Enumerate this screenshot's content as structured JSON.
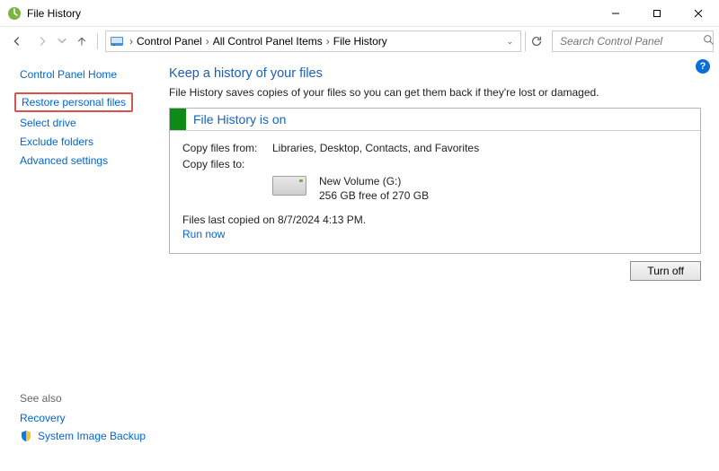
{
  "window": {
    "title": "File History",
    "controls": {
      "min": "—",
      "max": "▢",
      "close": "✕"
    }
  },
  "navbar": {
    "breadcrumbs": [
      "Control Panel",
      "All Control Panel Items",
      "File History"
    ],
    "search_placeholder": "Search Control Panel"
  },
  "sidebar": {
    "home": "Control Panel Home",
    "links": [
      {
        "label": "Restore personal files",
        "highlight": true
      },
      {
        "label": "Select drive",
        "highlight": false
      },
      {
        "label": "Exclude folders",
        "highlight": false
      },
      {
        "label": "Advanced settings",
        "highlight": false
      }
    ],
    "see_also_heading": "See also",
    "see_also": [
      {
        "label": "Recovery",
        "shield": false
      },
      {
        "label": "System Image Backup",
        "shield": true
      }
    ]
  },
  "main": {
    "title": "Keep a history of your files",
    "description": "File History saves copies of your files so you can get them back if they're lost or damaged.",
    "panel_header": "File History is on",
    "copy_from_label": "Copy files from:",
    "copy_from_value": "Libraries, Desktop, Contacts, and Favorites",
    "copy_to_label": "Copy files to:",
    "drive_name": "New Volume (G:)",
    "drive_free": "256 GB free of 270 GB",
    "last_copy": "Files last copied on 8/7/2024 4:13 PM.",
    "run_now": "Run now",
    "turn_off": "Turn off"
  },
  "help_badge": "?"
}
